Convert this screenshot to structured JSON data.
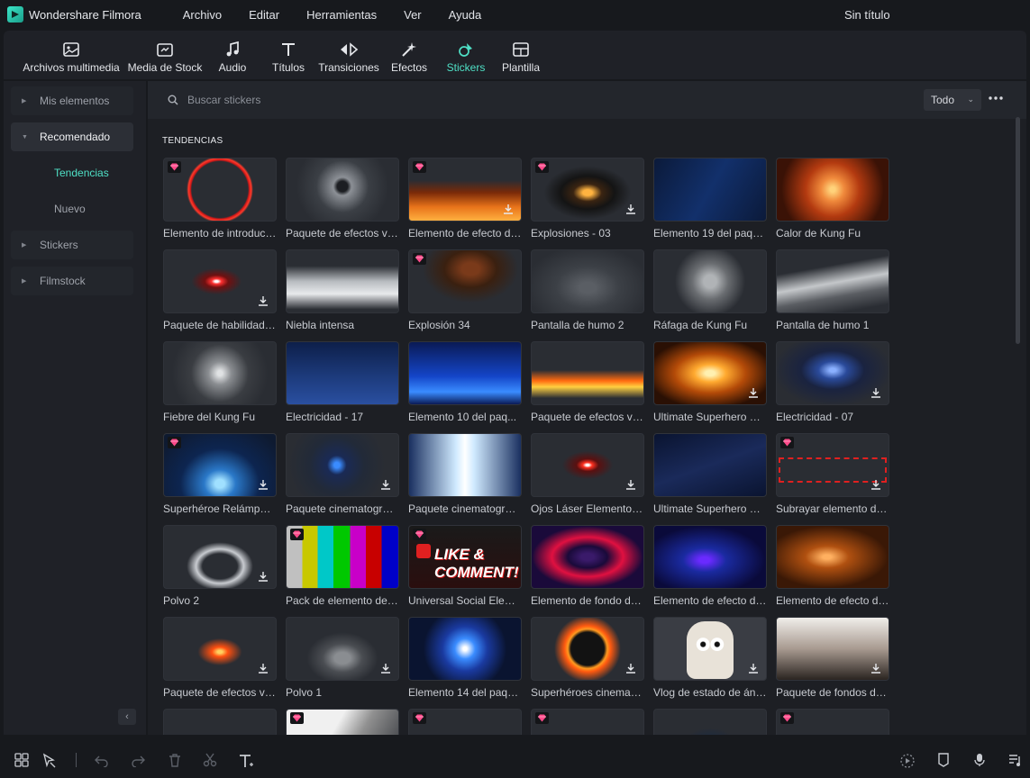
{
  "app": {
    "name": "Wondershare Filmora",
    "doc_title": "Sin título",
    "logo_icon": "filmora-logo-icon"
  },
  "menu": [
    "Archivo",
    "Editar",
    "Herramientas",
    "Ver",
    "Ayuda"
  ],
  "toolbar": {
    "tabs": [
      {
        "label": "Archivos multimedia",
        "icon": "media-icon"
      },
      {
        "label": "Media de Stock",
        "icon": "stock-media-icon"
      },
      {
        "label": "Audio",
        "icon": "music-note-icon"
      },
      {
        "label": "Títulos",
        "icon": "text-icon"
      },
      {
        "label": "Transiciones",
        "icon": "transition-icon"
      },
      {
        "label": "Efectos",
        "icon": "effects-icon"
      },
      {
        "label": "Stickers",
        "icon": "sticker-icon"
      },
      {
        "label": "Plantilla",
        "icon": "template-icon"
      }
    ],
    "active": "Stickers",
    "accent_color": "#4fe0c6"
  },
  "sidebar": {
    "items": [
      {
        "label": "Mis elementos"
      },
      {
        "label": "Recomendado"
      },
      {
        "label": "Tendencias"
      },
      {
        "label": "Nuevo"
      },
      {
        "label": "Stickers"
      },
      {
        "label": "Filmstock"
      }
    ],
    "selected": "Recomendado",
    "active_sub": "Tendencias"
  },
  "search": {
    "placeholder": "Buscar stickers"
  },
  "filter": {
    "selected": "Todo"
  },
  "section": {
    "title": "TENDENCIAS"
  },
  "stickers": [
    {
      "label": "Elemento de introducc...",
      "premium": true,
      "download": false
    },
    {
      "label": "Paquete de efectos vis...",
      "premium": false,
      "download": false
    },
    {
      "label": "Elemento de efecto de...",
      "premium": true,
      "download": true
    },
    {
      "label": "Explosiones - 03",
      "premium": true,
      "download": true
    },
    {
      "label": "Elemento 19 del paqu...",
      "premium": false,
      "download": false
    },
    {
      "label": "Calor de Kung Fu",
      "premium": false,
      "download": false
    },
    {
      "label": "Paquete de habilidade...",
      "premium": false,
      "download": true
    },
    {
      "label": "Niebla intensa",
      "premium": false,
      "download": false
    },
    {
      "label": "Explosión 34",
      "premium": true,
      "download": false
    },
    {
      "label": "Pantalla de humo 2",
      "premium": false,
      "download": false
    },
    {
      "label": "Ráfaga de Kung Fu",
      "premium": false,
      "download": false
    },
    {
      "label": "Pantalla de humo 1",
      "premium": false,
      "download": false
    },
    {
      "label": "Fiebre del Kung Fu",
      "premium": false,
      "download": false
    },
    {
      "label": "Electricidad - 17",
      "premium": false,
      "download": false
    },
    {
      "label": "Elemento 10 del paq...",
      "premium": false,
      "download": false
    },
    {
      "label": "Paquete de efectos vis...",
      "premium": false,
      "download": false
    },
    {
      "label": "Ultimate Superhero El...",
      "premium": false,
      "download": true
    },
    {
      "label": "Electricidad - 07",
      "premium": false,
      "download": true
    },
    {
      "label": "Superhéroe Relámpag...",
      "premium": true,
      "download": true
    },
    {
      "label": "Paquete cinematográf...",
      "premium": false,
      "download": true
    },
    {
      "label": "Paquete cinematográf...",
      "premium": false,
      "download": false
    },
    {
      "label": "Ojos Láser Elemento 01",
      "premium": false,
      "download": true
    },
    {
      "label": "Ultimate Superhero El...",
      "premium": false,
      "download": false
    },
    {
      "label": "Subrayar elemento del...",
      "premium": true,
      "download": true
    },
    {
      "label": "Polvo 2",
      "premium": false,
      "download": true
    },
    {
      "label": "Pack de elemento de ...",
      "premium": true,
      "download": false
    },
    {
      "label": "Universal Social Eleme...",
      "premium": true,
      "download": false
    },
    {
      "label": "Elemento de fondo de...",
      "premium": false,
      "download": false
    },
    {
      "label": "Elemento de efecto de...",
      "premium": false,
      "download": false
    },
    {
      "label": "Elemento de efecto de...",
      "premium": false,
      "download": false
    },
    {
      "label": "Paquete de efectos vis...",
      "premium": false,
      "download": true
    },
    {
      "label": "Polvo 1",
      "premium": false,
      "download": true
    },
    {
      "label": "Elemento 14 del paqu...",
      "premium": false,
      "download": false
    },
    {
      "label": "Superhéroes cinemato...",
      "premium": false,
      "download": true
    },
    {
      "label": "Vlog de estado de áni...",
      "premium": false,
      "download": true
    },
    {
      "label": "Paquete de fondos de ...",
      "premium": false,
      "download": true
    },
    {
      "label": "",
      "premium": false,
      "download": false
    },
    {
      "label": "",
      "premium": true,
      "download": false
    },
    {
      "label": "",
      "premium": true,
      "download": false
    },
    {
      "label": "",
      "premium": true,
      "download": false
    },
    {
      "label": "",
      "premium": false,
      "download": false
    },
    {
      "label": "",
      "premium": true,
      "download": false
    }
  ],
  "sticker_thumb_text": {
    "like_comment": "LIKE & COMMENT!"
  },
  "bottom_toolbar": [
    "layout-icon",
    "select-arrow-icon",
    "undo-icon",
    "redo-icon",
    "delete-icon",
    "cut-icon",
    "text-tool-icon",
    "render-icon",
    "marker-icon",
    "microphone-icon",
    "audio-list-icon"
  ]
}
